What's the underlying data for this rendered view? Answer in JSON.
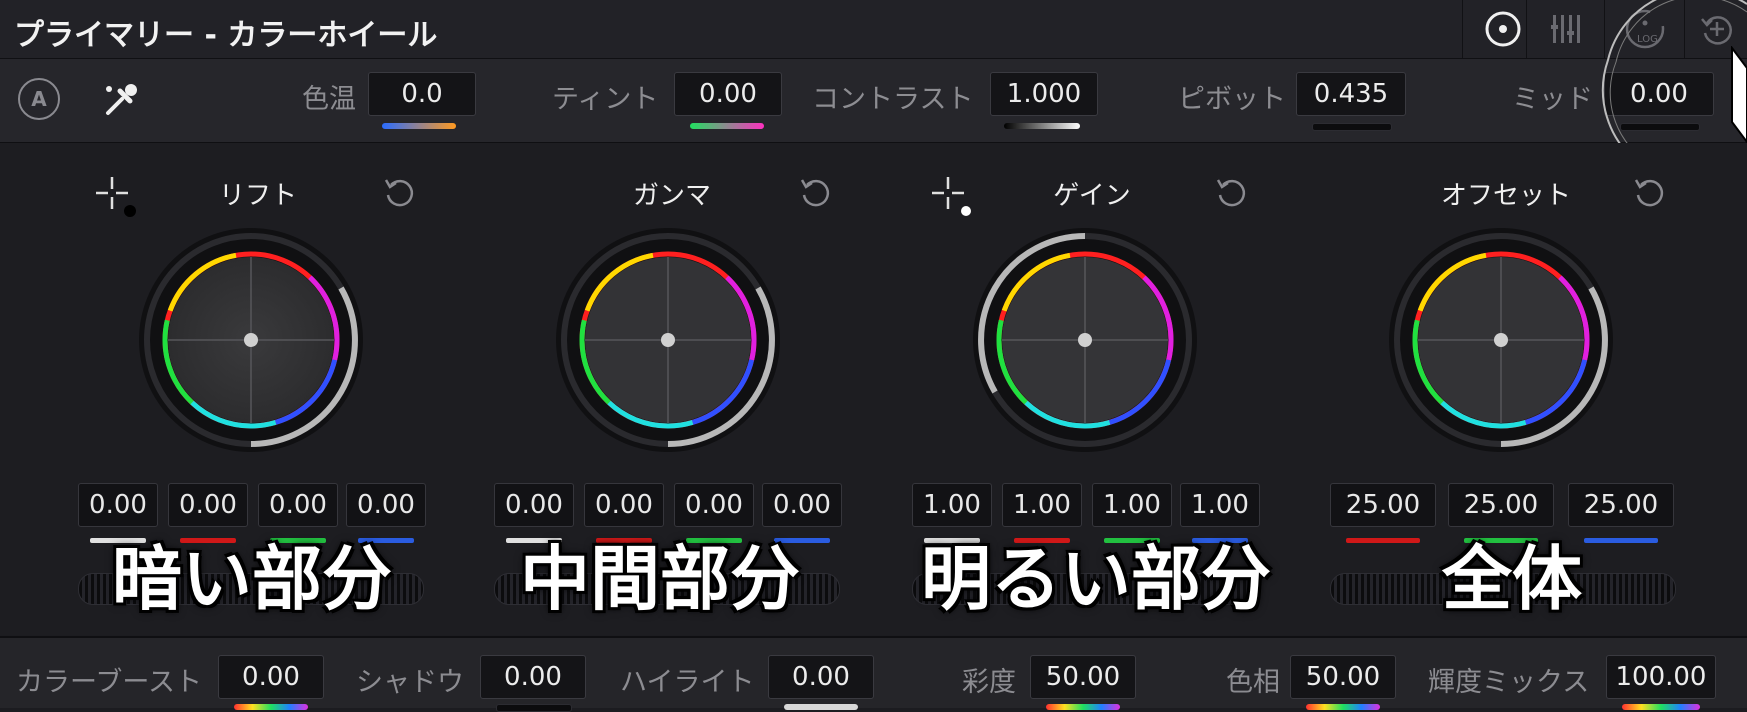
{
  "window": {
    "title": "プライマリー - カラーホイール"
  },
  "toolbar": {
    "auto_label": "A",
    "params": [
      {
        "label": "色温",
        "value": "0.0"
      },
      {
        "label": "ティント",
        "value": "0.00"
      },
      {
        "label": "コントラスト",
        "value": "1.000"
      },
      {
        "label": "ピボット",
        "value": "0.435"
      },
      {
        "label": "ミッド",
        "value": "0.00"
      }
    ]
  },
  "mode_buttons": {
    "log_label": "LOG"
  },
  "wheels": [
    {
      "title": "リフト",
      "values": [
        "0.00",
        "0.00",
        "0.00",
        "0.00"
      ],
      "overlay": "暗い部分"
    },
    {
      "title": "ガンマ",
      "values": [
        "0.00",
        "0.00",
        "0.00",
        "0.00"
      ],
      "overlay": "中間部分"
    },
    {
      "title": "ゲイン",
      "values": [
        "1.00",
        "1.00",
        "1.00",
        "1.00"
      ],
      "overlay": "明るい部分"
    },
    {
      "title": "オフセット",
      "values": [
        "25.00",
        "25.00",
        "25.00"
      ],
      "overlay": "全体"
    }
  ],
  "bottom": {
    "params": [
      {
        "label": "カラーブースト",
        "value": "0.00"
      },
      {
        "label": "シャドウ",
        "value": "0.00"
      },
      {
        "label": "ハイライト",
        "value": "0.00"
      },
      {
        "label": "彩度",
        "value": "50.00"
      },
      {
        "label": "色相",
        "value": "50.00"
      },
      {
        "label": "輝度ミックス",
        "value": "100.00"
      }
    ]
  },
  "colors": {
    "red": "#d01818",
    "green": "#22c040",
    "blue": "#2a5ce0",
    "accent": "#ececec"
  }
}
